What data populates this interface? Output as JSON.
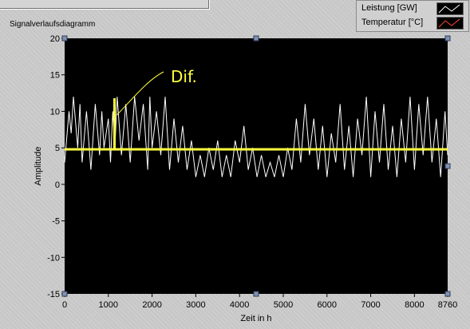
{
  "chart_title": "Signalverlaufsdiagramm",
  "legend": [
    {
      "label": "Leistung [GW]",
      "color": "#ffffff"
    },
    {
      "label": "Temperatur [°C]",
      "color": "#ff4a2a"
    }
  ],
  "annotation": {
    "text": "Dif.",
    "color": "#ffff40",
    "x": 1140
  },
  "chart_data": {
    "type": "line",
    "title": "",
    "xlabel": "Zeit in h",
    "ylabel": "Amplitude",
    "xlim": [
      0,
      8760
    ],
    "ylim": [
      -15,
      20
    ],
    "x_ticks": [
      0,
      1000,
      2000,
      3000,
      4000,
      5000,
      6000,
      7000,
      8000,
      8760
    ],
    "y_ticks": [
      -15,
      -10,
      -5,
      0,
      5,
      10,
      15,
      20
    ],
    "grid": false,
    "background": "#000000",
    "series": [
      {
        "name": "Leistung [GW]",
        "color": "#ffffff",
        "x": [
          0,
          100,
          150,
          200,
          300,
          350,
          400,
          500,
          600,
          700,
          800,
          850,
          900,
          1000,
          1050,
          1100,
          1150,
          1200,
          1300,
          1400,
          1500,
          1600,
          1700,
          1800,
          1900,
          1950,
          2000,
          2100,
          2200,
          2300,
          2400,
          2500,
          2600,
          2700,
          2800,
          2900,
          3000,
          3100,
          3200,
          3300,
          3400,
          3500,
          3600,
          3700,
          3800,
          3900,
          4000,
          4100,
          4200,
          4300,
          4400,
          4500,
          4600,
          4700,
          4800,
          4900,
          5000,
          5100,
          5200,
          5300,
          5400,
          5500,
          5600,
          5700,
          5800,
          5900,
          6000,
          6100,
          6200,
          6300,
          6400,
          6500,
          6600,
          6700,
          6800,
          6900,
          7000,
          7100,
          7200,
          7300,
          7400,
          7500,
          7600,
          7700,
          7800,
          7900,
          8000,
          8100,
          8200,
          8300,
          8400,
          8500,
          8600,
          8700,
          8760
        ],
        "values": [
          3,
          10,
          7,
          12,
          5,
          11,
          3,
          10,
          2,
          11,
          4,
          10,
          5,
          9,
          3,
          10,
          5,
          12,
          4,
          11,
          3,
          12,
          6,
          11,
          2,
          12,
          5,
          10,
          4,
          12,
          2,
          9,
          3,
          8,
          2,
          6,
          1,
          4,
          1,
          5,
          2,
          6,
          1,
          4,
          1,
          6,
          3,
          8,
          2,
          5,
          1,
          4,
          1,
          3,
          1,
          4,
          1,
          5,
          2,
          9,
          3,
          11,
          4,
          9,
          2,
          8,
          1,
          7,
          3,
          11,
          2,
          8,
          1,
          9,
          4,
          12,
          1,
          10,
          3,
          11,
          2,
          8,
          1,
          9,
          3,
          12,
          2,
          11,
          4,
          12,
          3,
          9,
          1,
          10,
          4
        ]
      },
      {
        "name": "Temperatur [°C]",
        "color": "#ffff40",
        "x": [
          0,
          8760
        ],
        "values": [
          4.8,
          4.8
        ]
      }
    ]
  }
}
